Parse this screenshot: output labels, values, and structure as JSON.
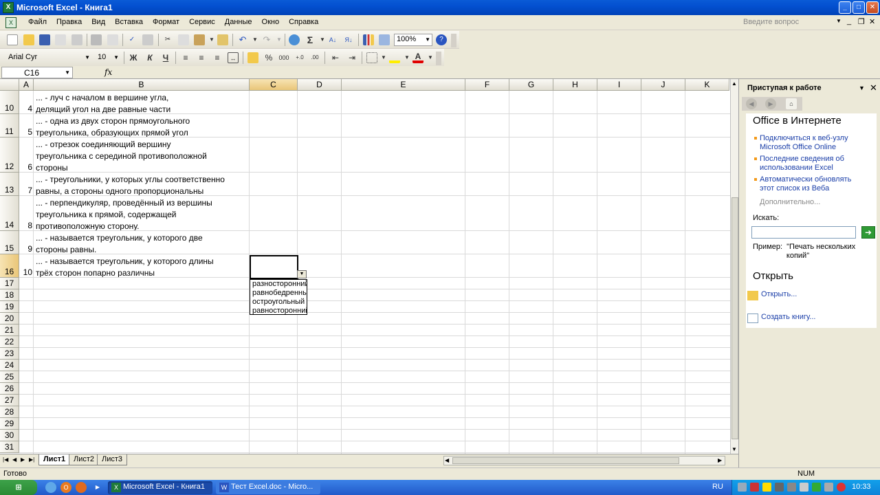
{
  "window": {
    "title": "Microsoft Excel - Книга1"
  },
  "menu": {
    "items": [
      "Файл",
      "Правка",
      "Вид",
      "Вставка",
      "Формат",
      "Сервис",
      "Данные",
      "Окно",
      "Справка"
    ],
    "ask_placeholder": "Введите вопрос"
  },
  "toolbar": {
    "zoom": "100%",
    "font": "Arial Cyr",
    "font_size": "10",
    "bold": "Ж",
    "italic": "К",
    "underline": "Ч"
  },
  "formula_bar": {
    "name_box": "C16",
    "fx": "fx"
  },
  "columns": [
    "A",
    "B",
    "C",
    "D",
    "E",
    "F",
    "G",
    "H",
    "I",
    "J",
    "K"
  ],
  "selected_cell": {
    "column": "C",
    "row": "16"
  },
  "rows": [
    {
      "num": "10",
      "a": "4",
      "b": "... - луч с началом в вершине угла,\nделящий угол на две равные части"
    },
    {
      "num": "11",
      "a": "5",
      "b": "... - одна из двух сторон прямоугольного\nтреугольника, образующих прямой угол"
    },
    {
      "num": "12",
      "a": "6",
      "b": "... - отрезок соединяющий вершину\nтреугольника с серединой противоположной\nстороны"
    },
    {
      "num": "13",
      "a": "7",
      "b": "... - треугольники, у которых углы соответственно\nравны, а стороны одного пропорциональны"
    },
    {
      "num": "14",
      "a": "8",
      "b": "... - перпендикуляр, проведённый из вершины\nтреугольника к прямой, содержащей\nпротивоположную сторону."
    },
    {
      "num": "15",
      "a": "9",
      "b": "... - называется треугольник, у которого две\nстороны равны."
    },
    {
      "num": "16",
      "a": "10",
      "b": "... - называется треугольник, у которого длины\nтрёх сторон попарно различны"
    }
  ],
  "empty_rows": [
    "17",
    "18",
    "19",
    "20",
    "21",
    "22",
    "23",
    "24",
    "25",
    "26",
    "27",
    "28",
    "29",
    "30",
    "31"
  ],
  "dropdown": {
    "options": [
      "разносторонний",
      "равнобедренный",
      "остроугольный",
      "равносторонний"
    ]
  },
  "sheets": {
    "tabs": [
      "Лист1",
      "Лист2",
      "Лист3"
    ],
    "active": "Лист1"
  },
  "task_pane": {
    "title": "Приступая к работе",
    "section_online": "Office в Интернете",
    "links": [
      "Подключиться к веб-узлу\nMicrosoft Office Online",
      "Последние сведения об\nиспользовании Excel",
      "Автоматически обновлять\nэтот список из Веба"
    ],
    "more": "Дополнительно...",
    "search_label": "Искать:",
    "example": "Пример:  \"Печать нескольких\n                копий\"",
    "section_open": "Открыть",
    "open_link": "Открыть...",
    "create_link": "Создать книгу..."
  },
  "status": {
    "left": "Готово",
    "num": "NUM"
  },
  "taskbar": {
    "tasks": [
      "Microsoft Excel - Книга1",
      "Тест Excel.doc - Micro..."
    ],
    "lang": "RU",
    "clock": "10:33"
  }
}
